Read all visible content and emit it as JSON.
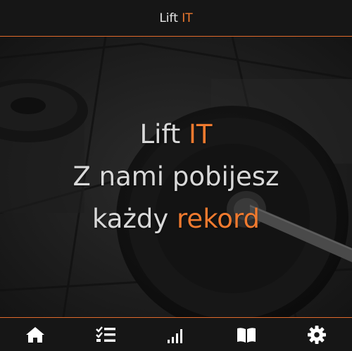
{
  "header": {
    "title_main": "Lift",
    "title_accent": "IT"
  },
  "hero": {
    "line1_main": "Lift",
    "line1_accent": "IT",
    "line2": "Z nami pobijesz",
    "line3_main": "każdy",
    "line3_accent": "rekord"
  },
  "nav": {
    "items": [
      {
        "icon": "home-icon"
      },
      {
        "icon": "checklist-icon"
      },
      {
        "icon": "signal-bars-icon"
      },
      {
        "icon": "book-icon"
      },
      {
        "icon": "gear-icon"
      }
    ]
  },
  "colors": {
    "accent": "#f07a2f",
    "background": "#161616",
    "text": "#d9d9d9"
  }
}
